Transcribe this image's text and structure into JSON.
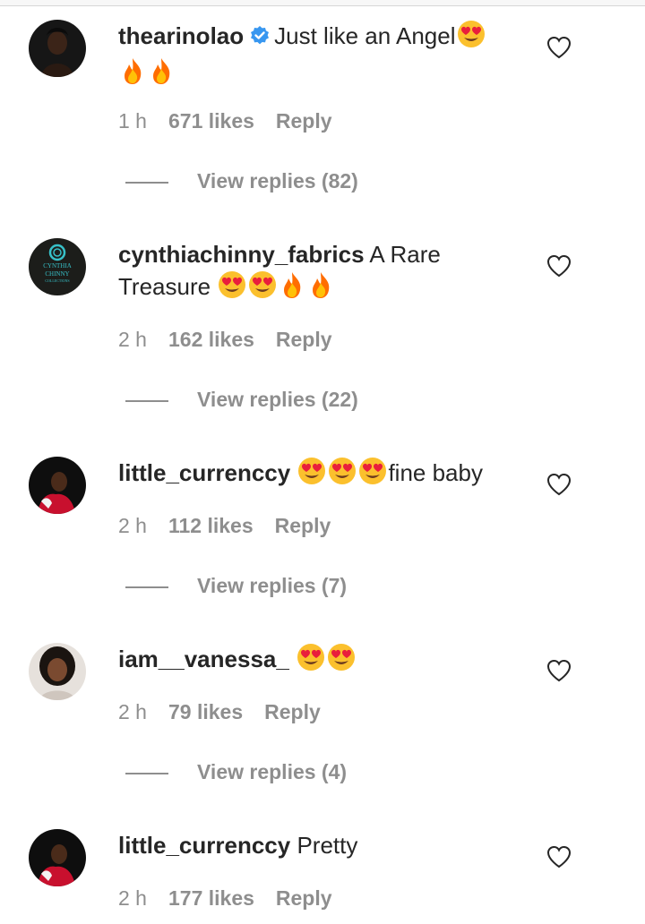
{
  "comments": [
    {
      "username": "thearinolao",
      "verified": true,
      "text": "Just like an Angel",
      "emojis_inline": [
        "heart-eyes-emoji"
      ],
      "emojis_line2": [
        "fire-emoji",
        "fire-emoji"
      ],
      "time": "1 h",
      "likes": "671 likes",
      "reply": "Reply",
      "view_replies": "View replies (82)"
    },
    {
      "username": "cynthiachinny_fabrics",
      "verified": false,
      "text_part1": "A Rare",
      "text_part2": "Treasure",
      "emojis_line2": [
        "heart-eyes-emoji",
        "heart-eyes-emoji",
        "fire-emoji",
        "fire-emoji"
      ],
      "avatar_text_1": "CYNTHIA",
      "avatar_text_2": "CHINNY",
      "avatar_text_3": "COLLECTIONS",
      "time": "2 h",
      "likes": "162 likes",
      "reply": "Reply",
      "view_replies": "View replies (22)"
    },
    {
      "username": "little_currenccy",
      "verified": false,
      "text": "fine baby",
      "emojis_before": [
        "heart-eyes-emoji",
        "heart-eyes-emoji",
        "heart-eyes-emoji"
      ],
      "time": "2 h",
      "likes": "112 likes",
      "reply": "Reply",
      "view_replies": "View replies (7)"
    },
    {
      "username": "iam__vanessa_",
      "verified": false,
      "text": "",
      "emojis_after": [
        "heart-eyes-emoji",
        "heart-eyes-emoji"
      ],
      "time": "2 h",
      "likes": "79 likes",
      "reply": "Reply",
      "view_replies": "View replies (4)"
    },
    {
      "username": "little_currenccy",
      "verified": false,
      "text": "Pretty",
      "time": "2 h",
      "likes": "177 likes",
      "reply": "Reply"
    }
  ],
  "colors": {
    "text": "#262626",
    "secondary": "#8e8e8e",
    "verified": "#3897f0"
  }
}
